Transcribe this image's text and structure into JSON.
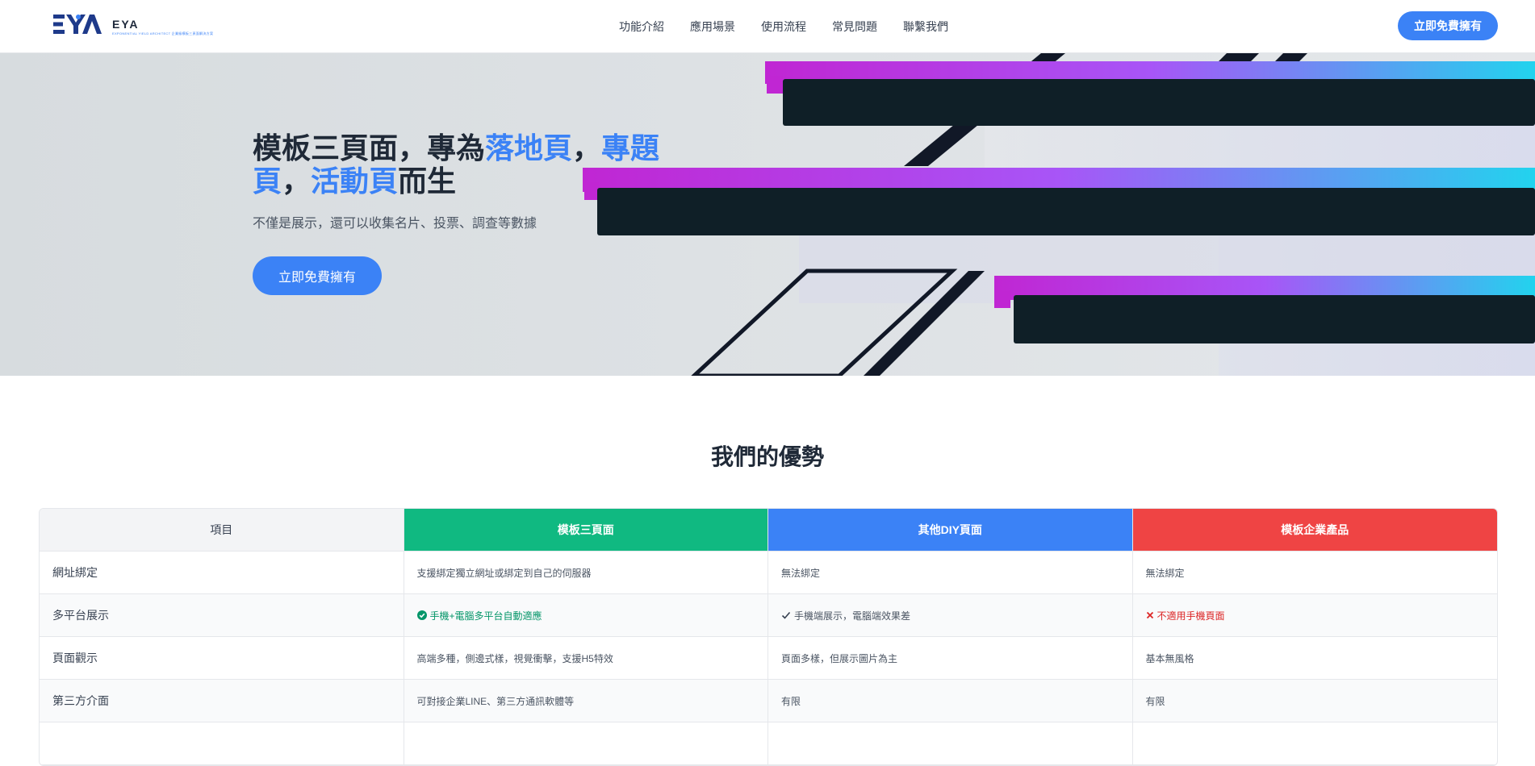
{
  "brand": {
    "name": "EYA",
    "tagline": "EXPONENTIAL YIELD ARCHITECT 企業級模板三頁面解決方案"
  },
  "nav": {
    "links": [
      "功能介紹",
      "應用場景",
      "使用流程",
      "常見問題",
      "聯繫我們"
    ],
    "cta": "立即免費擁有"
  },
  "hero": {
    "title_part1": "模板三頁面，專為",
    "title_hl1": "落地頁",
    "title_sep1": "，",
    "title_hl2": "專題頁",
    "title_sep2": "，",
    "title_hl3": "活動頁",
    "title_part2": "而生",
    "subtitle": "不僅是展示，還可以收集名片、投票、調查等數據",
    "cta": "立即免費擁有"
  },
  "advantages": {
    "title": "我們的優勢",
    "headers": [
      "項目",
      "模板三頁面",
      "其他DIY頁面",
      "模板企業產品"
    ],
    "rows": [
      {
        "label": "網址綁定",
        "a": "支援綁定獨立網址或綁定到自己的伺服器",
        "b": "無法綁定",
        "c": "無法綁定"
      },
      {
        "label": "多平台展示",
        "a": "手機+電腦多平台自動適應",
        "b": "手機端展示，電腦端效果差",
        "c": "不適用手機頁面"
      },
      {
        "label": "頁面觀示",
        "a": "高端多種，側邊式樣，視覺衝擊，支援H5特效",
        "b": "頁面多樣，但展示圖片為主",
        "c": "基本無風格"
      },
      {
        "label": "第三方介面",
        "a": "可對接企業LINE、第三方通訊軟體等",
        "b": "有限",
        "c": "有限"
      }
    ]
  },
  "colors": {
    "accent": "#3b82f6",
    "green": "#10b981",
    "red": "#ef4444",
    "hero_bg": "#dde1e4"
  },
  "icons": {
    "check_circle": "check-circle-icon",
    "check": "check-icon",
    "cross": "cross-icon"
  }
}
